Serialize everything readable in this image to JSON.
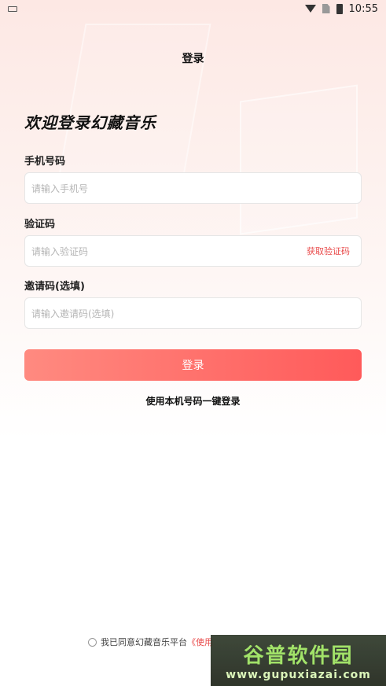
{
  "status_bar": {
    "time": "10:55"
  },
  "header": {
    "title": "登录"
  },
  "welcome": "欢迎登录幻藏音乐",
  "form": {
    "phone": {
      "label": "手机号码",
      "placeholder": "请输入手机号"
    },
    "code": {
      "label": "验证码",
      "placeholder": "请输入验证码",
      "get_code": "获取验证码"
    },
    "invite": {
      "label": "邀请码(选填)",
      "placeholder": "请输入邀请码(选填)"
    },
    "login_button": "登录",
    "one_key_login": "使用本机号码一键登录"
  },
  "agreement": {
    "text": "我已同意幻藏音乐平台",
    "link": "《使用"
  },
  "watermark": {
    "title": "谷普软件园",
    "url": "www.gupuxiazai.com"
  },
  "colors": {
    "accent": "#ff5a5a",
    "accent_start": "#ff8a80",
    "link": "#e94b4b"
  }
}
